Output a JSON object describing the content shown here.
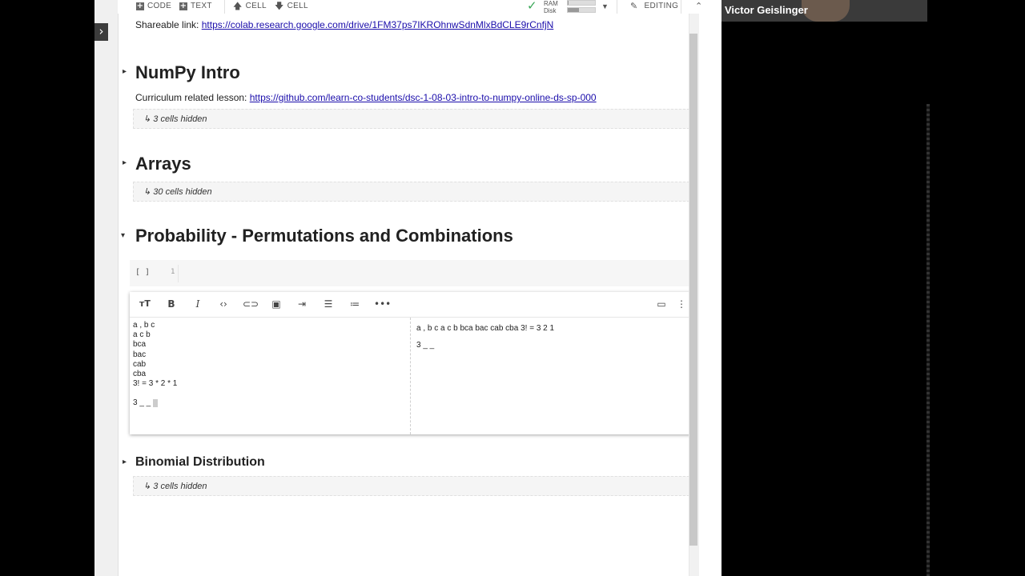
{
  "toolbar": {
    "code_label": "CODE",
    "text_label": "TEXT",
    "cell_up_label": "CELL",
    "cell_down_label": "CELL",
    "ram_label": "RAM",
    "disk_label": "Disk",
    "editing_label": "EDITING"
  },
  "gutter": {
    "toggle_glyph": "›"
  },
  "notebook": {
    "shareable_prefix": "Shareable link:",
    "shareable_url": "https://colab.research.google.com/drive/1FM37ps7IKROhnwSdnMlxBdCLE9rCnfjN",
    "sections": [
      {
        "title": "NumPy Intro",
        "lesson_prefix": "Curriculum related lesson:",
        "lesson_url": "https://github.com/learn-co-students/dsc-1-08-03-intro-to-numpy-online-ds-sp-000",
        "hidden_text": "↳ 3 cells hidden"
      },
      {
        "title": "Arrays",
        "hidden_text": "↳ 30 cells hidden"
      },
      {
        "title": "Probability - Permutations and Combinations"
      },
      {
        "title": "Binomial Distribution",
        "hidden_text": "↳ 3 cells hidden"
      }
    ],
    "code_cell": {
      "run_indicator": "[ ]",
      "line_number": "1"
    },
    "editor": {
      "source_lines": [
        "a , b c",
        "a c b",
        "bca",
        "bac",
        "cab",
        "cba",
        "3! = 3 * 2 * 1"
      ],
      "source_tail": "3 _ _",
      "preview_line1": "a , b c a c b bca bac cab cba 3! = 3 2 1",
      "preview_line2": "3 _ _"
    }
  },
  "participant": {
    "name": "Victor Geislinger"
  },
  "colors": {
    "link": "#1a0dab",
    "check": "#3aa757"
  },
  "resources": {
    "ram_fraction": 0.02,
    "disk_fraction": 0.4
  }
}
